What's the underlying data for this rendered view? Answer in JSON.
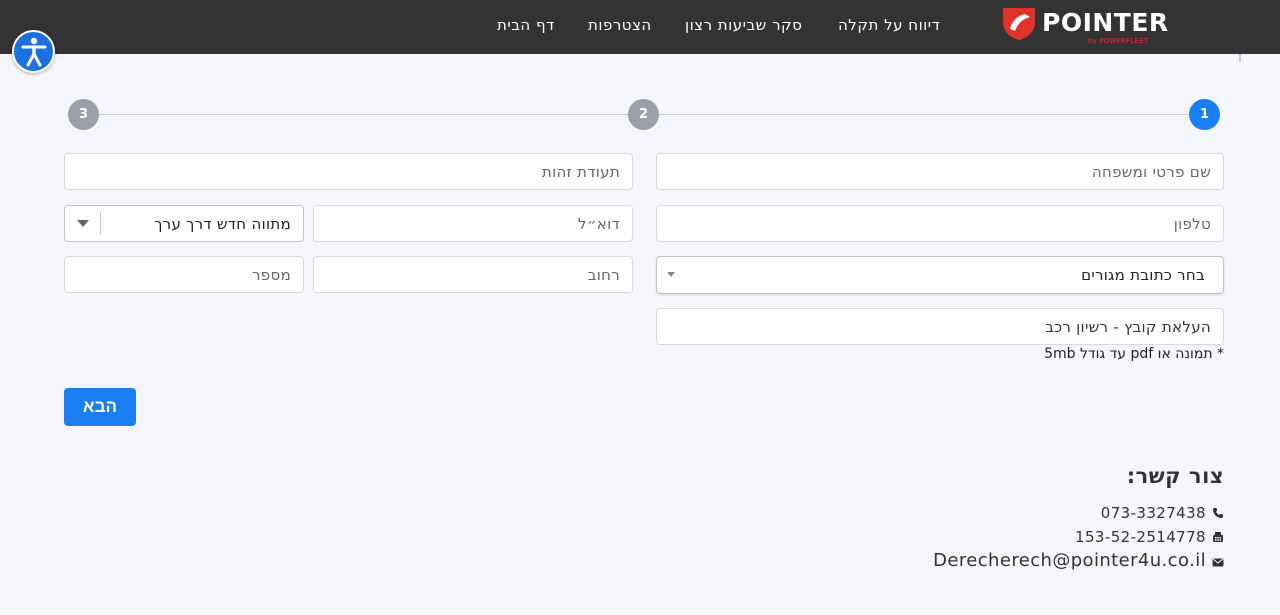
{
  "nav": {
    "home": "דף הבית",
    "join": "הצטרפות",
    "survey": "סקר שביעות רצון",
    "report": "דיווח על תקלה"
  },
  "logo": {
    "word": "POINTER",
    "sub": "by POWERFLEET"
  },
  "steps": [
    "1",
    "2",
    "3"
  ],
  "form": {
    "full_name_placeholder": "שם פרטי ומשפחה",
    "id_placeholder": "תעודת זהות",
    "phone_placeholder": "טלפון",
    "email_placeholder": "דוא״ל",
    "route_select": "מתווה חדש דרך ערך",
    "address_select": "בחר כתובת מגורים",
    "street_placeholder": "רחוב",
    "number_placeholder": "מספר",
    "upload_label": "העלאת קובץ - רשיון רכב",
    "upload_note": "* תמונה או pdf עד גודל 5mb",
    "next_label": "הבא"
  },
  "contact": {
    "title": "צור קשר:",
    "phone": "073-3327438",
    "fax": "153-52-2514778",
    "email": "Derecherech@pointer4u.co.il"
  },
  "colors": {
    "accent": "#1a7ef5",
    "topbar": "#333333",
    "brand_red": "#e2332b"
  },
  "icons": [
    "accessibility-icon",
    "phone-icon",
    "fax-icon",
    "envelope-icon",
    "chevron-down-icon"
  ]
}
